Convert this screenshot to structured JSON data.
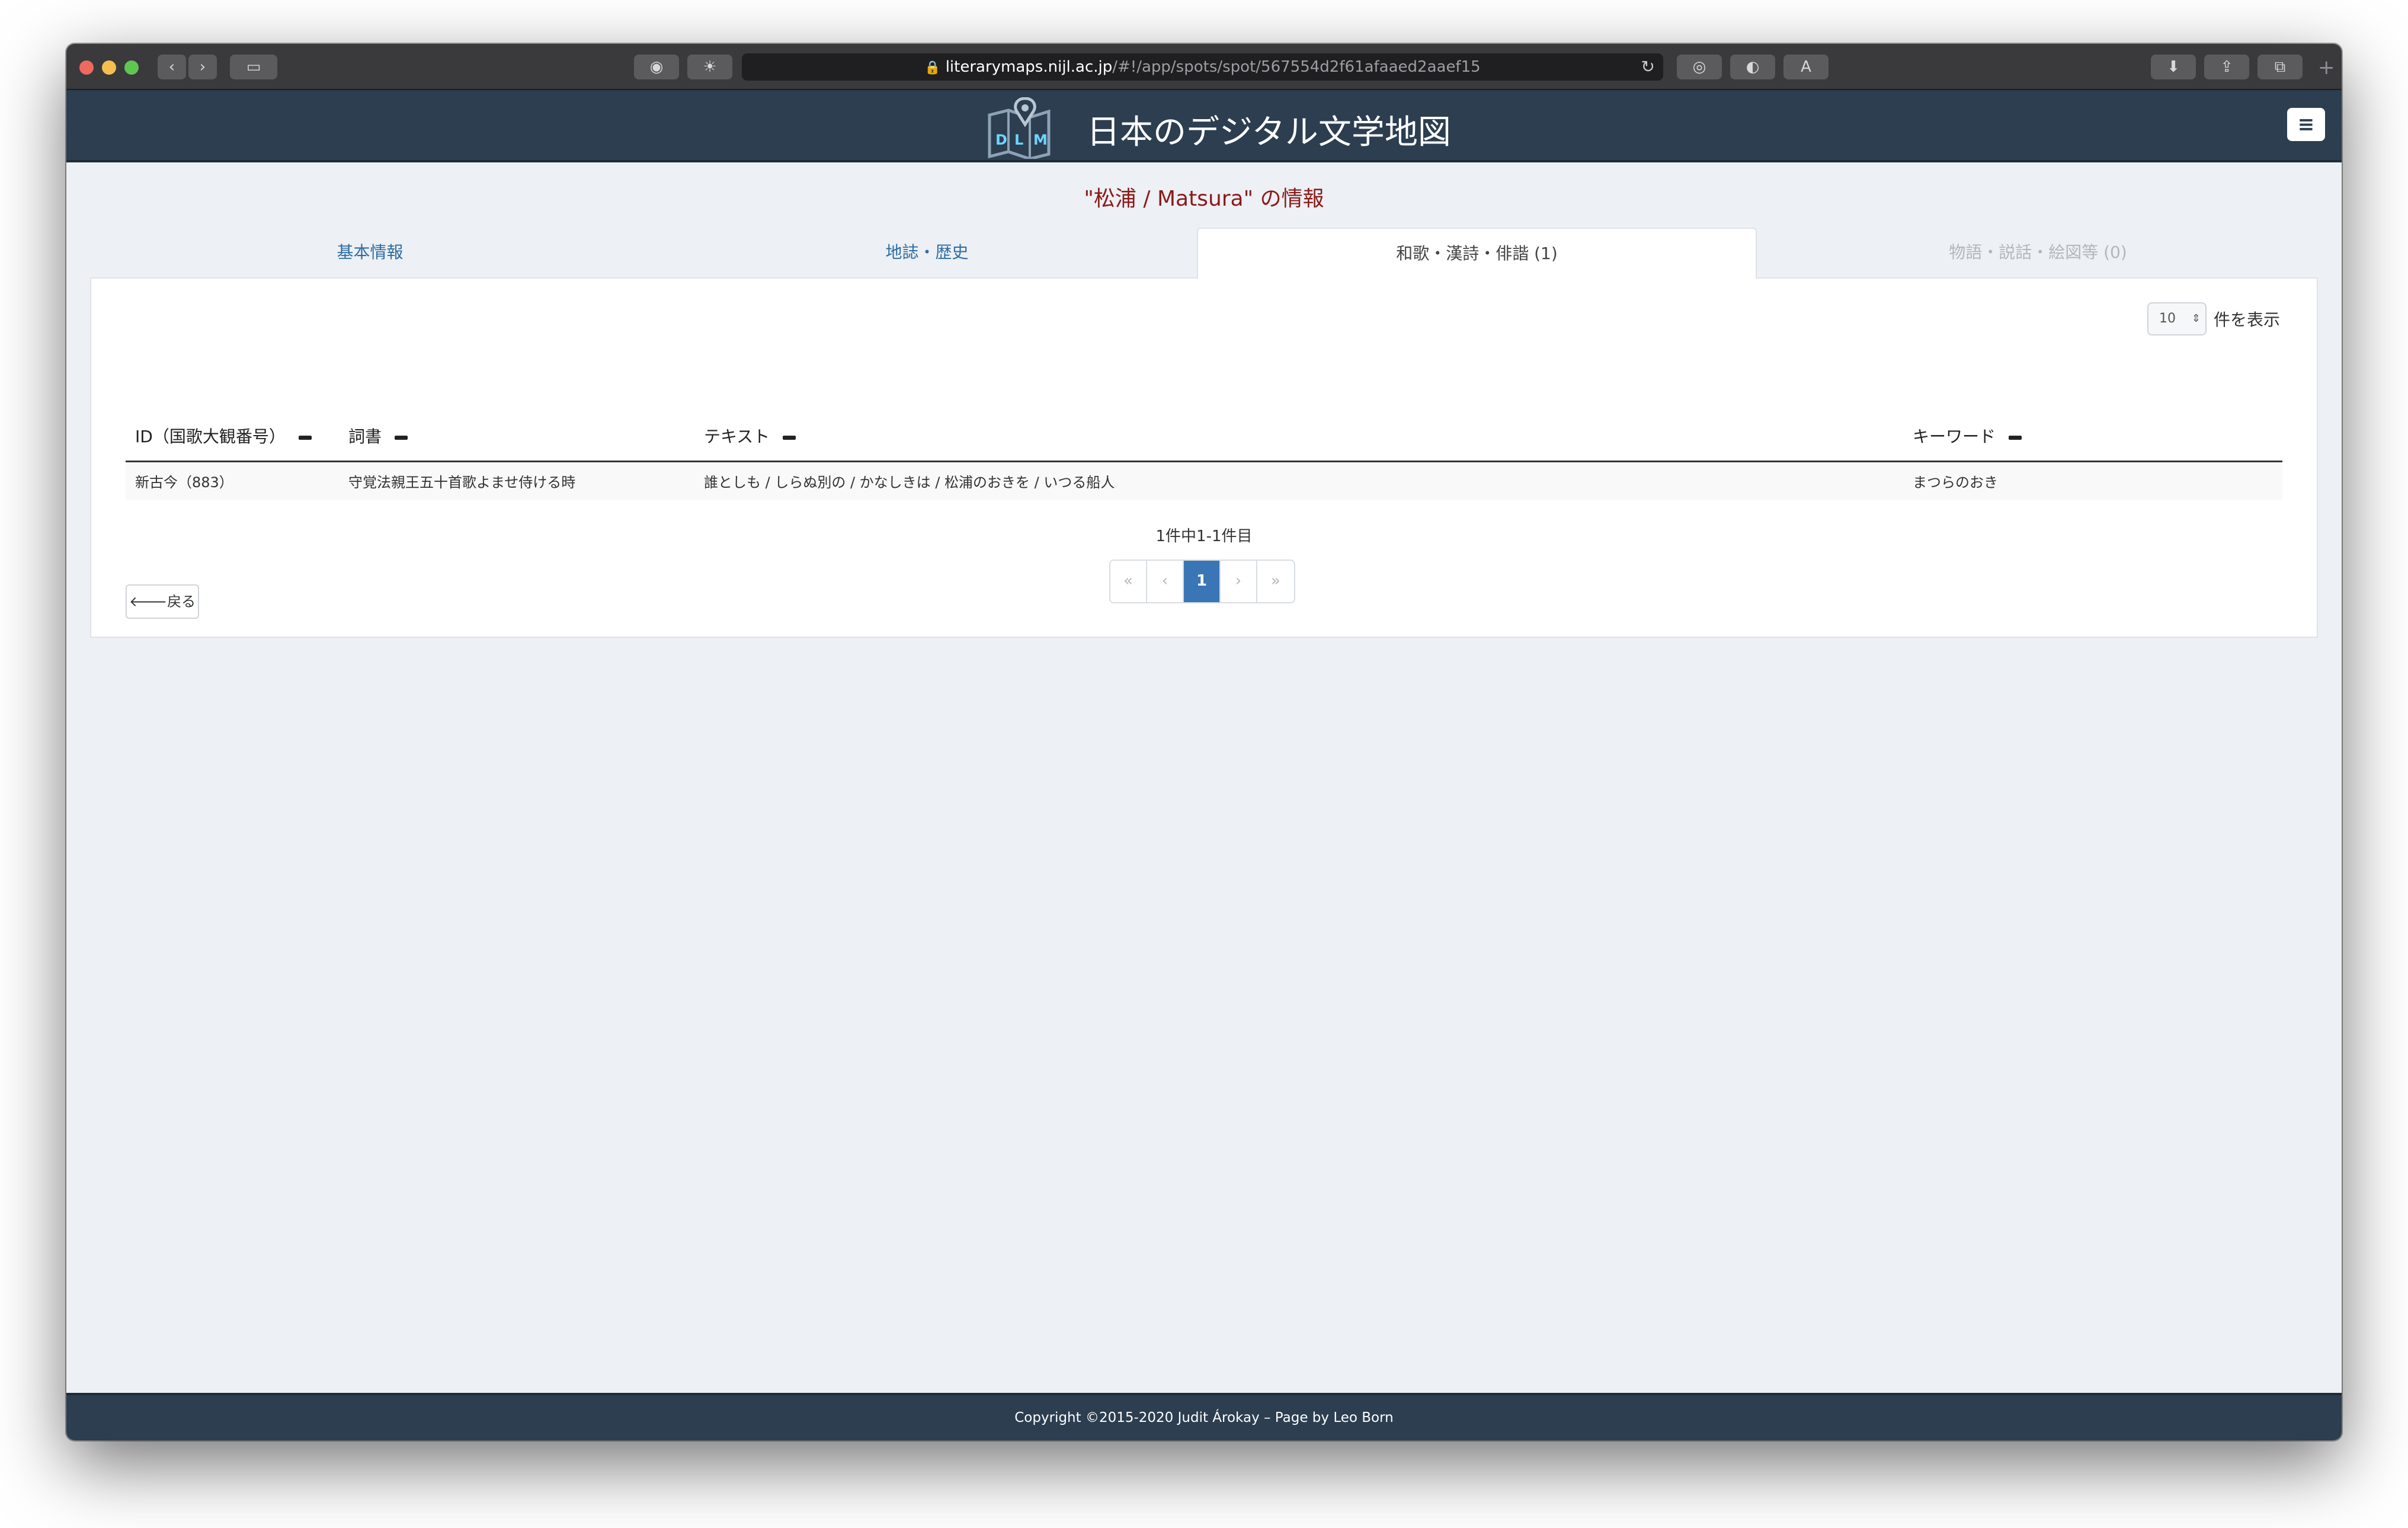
{
  "browser": {
    "url_host": "literarymaps.nijl.ac.jp",
    "url_path": "/#!/app/spots/spot/567554d2f61afaaed2aaef15",
    "tab_plus": "+"
  },
  "app": {
    "title": "日本のデジタル文学地図",
    "logo_letters": [
      "D",
      "L",
      "M"
    ],
    "menu_icon": "≡"
  },
  "page": {
    "heading": "\"松浦 / Matsura\" の情報"
  },
  "tabs": [
    {
      "label": "基本情報",
      "state": "link"
    },
    {
      "label": "地誌・歴史",
      "state": "link"
    },
    {
      "label": "和歌・漢詩・俳諧 (1)",
      "state": "active"
    },
    {
      "label": "物語・説話・絵図等 (0)",
      "state": "disabled"
    }
  ],
  "per_page": {
    "value": "10",
    "label": "件を表示"
  },
  "table": {
    "headers": [
      "ID（国歌大観番号）",
      "詞書",
      "テキスト",
      "キーワード"
    ],
    "rows": [
      [
        "新古今（883）",
        "守覚法親王五十首歌よませ侍ける時",
        "誰としも / しらぬ別の / かなしきは / 松浦のおきを / いつる船人",
        "まつらのおき"
      ]
    ]
  },
  "pagination": {
    "info": "1件中1-1件目",
    "buttons": [
      "«",
      "‹",
      "1",
      "›",
      "»"
    ],
    "current": "1"
  },
  "back_button": {
    "icon": "🡐",
    "label": "戻る"
  },
  "footer": {
    "text": "Copyright ©2015-2020 Judit Árokay – Page by Leo Born"
  },
  "colors": {
    "header_bg": "#2c3e50",
    "heading_text": "#8b1a1a",
    "link": "#2e6da4",
    "pager_active": "#3a76b5"
  }
}
